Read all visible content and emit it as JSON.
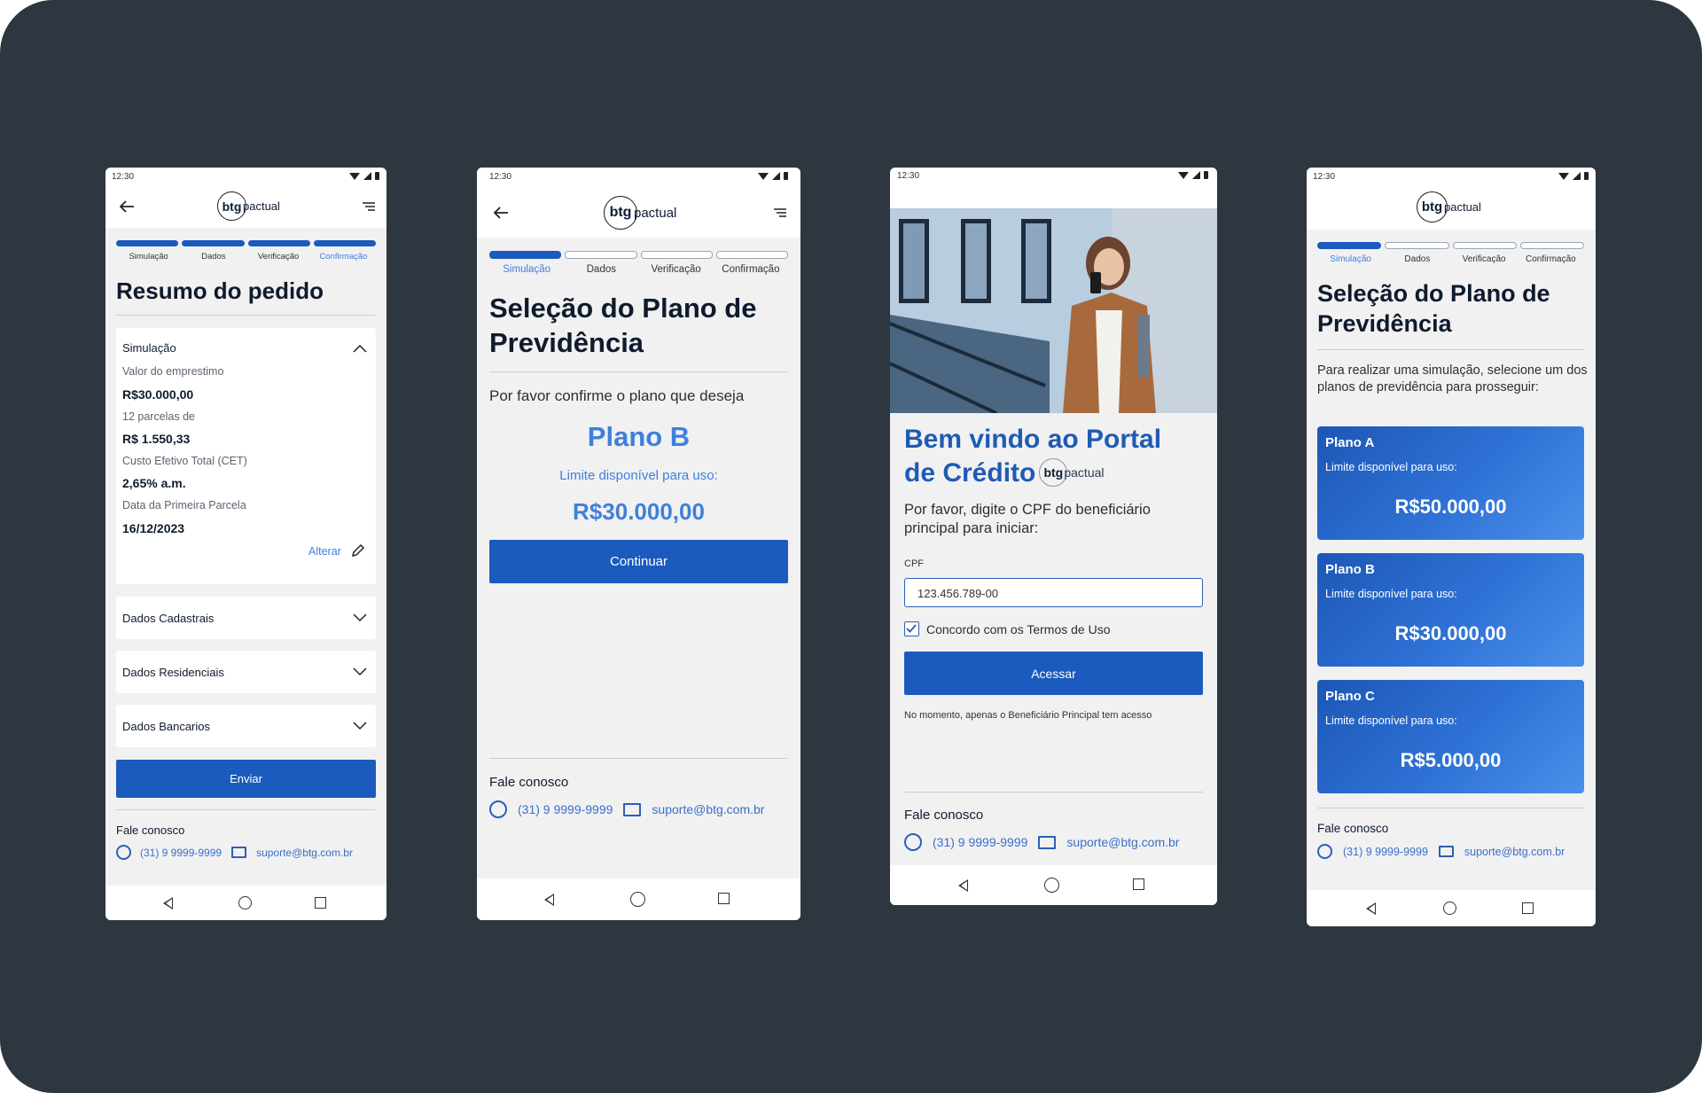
{
  "status": {
    "time": "12:30"
  },
  "logo": {
    "mark": "btg",
    "word": "pactual"
  },
  "steps": [
    "Simulação",
    "Dados",
    "Verificação",
    "Confirmação"
  ],
  "contact": {
    "title": "Fale conosco",
    "phone": "(31) 9 9999-9999",
    "email": "suporte@btg.com.br"
  },
  "colors": {
    "primary": "#1a5bbd",
    "accent": "#3f7fdc",
    "background": "#2e363f"
  },
  "screen1": {
    "title": "Resumo do pedido",
    "active_step": 4,
    "simulation": {
      "header": "Simulação",
      "rows": [
        {
          "label": "Valor do emprestimo",
          "value": "R$30.000,00"
        },
        {
          "label": "12 parcelas de",
          "value": "R$ 1.550,33"
        },
        {
          "label": "Custo Efetivo Total (CET)",
          "value": "2,65% a.m."
        },
        {
          "label": "Data da Primeira Parcela",
          "value": "16/12/2023"
        }
      ],
      "edit_label": "Alterar"
    },
    "sections": [
      "Dados Cadastrais",
      "Dados Residenciais",
      "Dados Bancarios"
    ],
    "submit_label": "Enviar"
  },
  "screen2": {
    "title_line1": "Seleção do Plano de",
    "title_line2": "Previdência",
    "prompt": "Por favor confirme o plano que deseja",
    "plan_name": "Plano B",
    "limit_label": "Limite disponível para uso:",
    "limit_value": "R$30.000,00",
    "continue_label": "Continuar",
    "active_step": 1
  },
  "screen3": {
    "title_line1": "Bem vindo ao Portal",
    "title_line2": "de Crédito",
    "instruction": "Por favor, digite o CPF do beneficiário principal para iniciar:",
    "cpf_label": "CPF",
    "cpf_value": "123.456.789-00",
    "terms_label": "Concordo com os Termos de Uso",
    "terms_checked": true,
    "access_label": "Acessar",
    "note": "No momento, apenas o Beneficiário Principal tem acesso"
  },
  "screen4": {
    "title_line1": "Seleção do Plano de",
    "title_line2": "Previdência",
    "intro": "Para realizar uma simulação, selecione um dos planos de previdência para prosseguir:",
    "active_step": 1,
    "plans": [
      {
        "name": "Plano A",
        "limit_label": "Limite disponível para uso:",
        "value": "R$50.000,00"
      },
      {
        "name": "Plano B",
        "limit_label": "Limite disponível para uso:",
        "value": "R$30.000,00"
      },
      {
        "name": "Plano C",
        "limit_label": "Limite disponível para uso:",
        "value": "R$5.000,00"
      }
    ]
  }
}
